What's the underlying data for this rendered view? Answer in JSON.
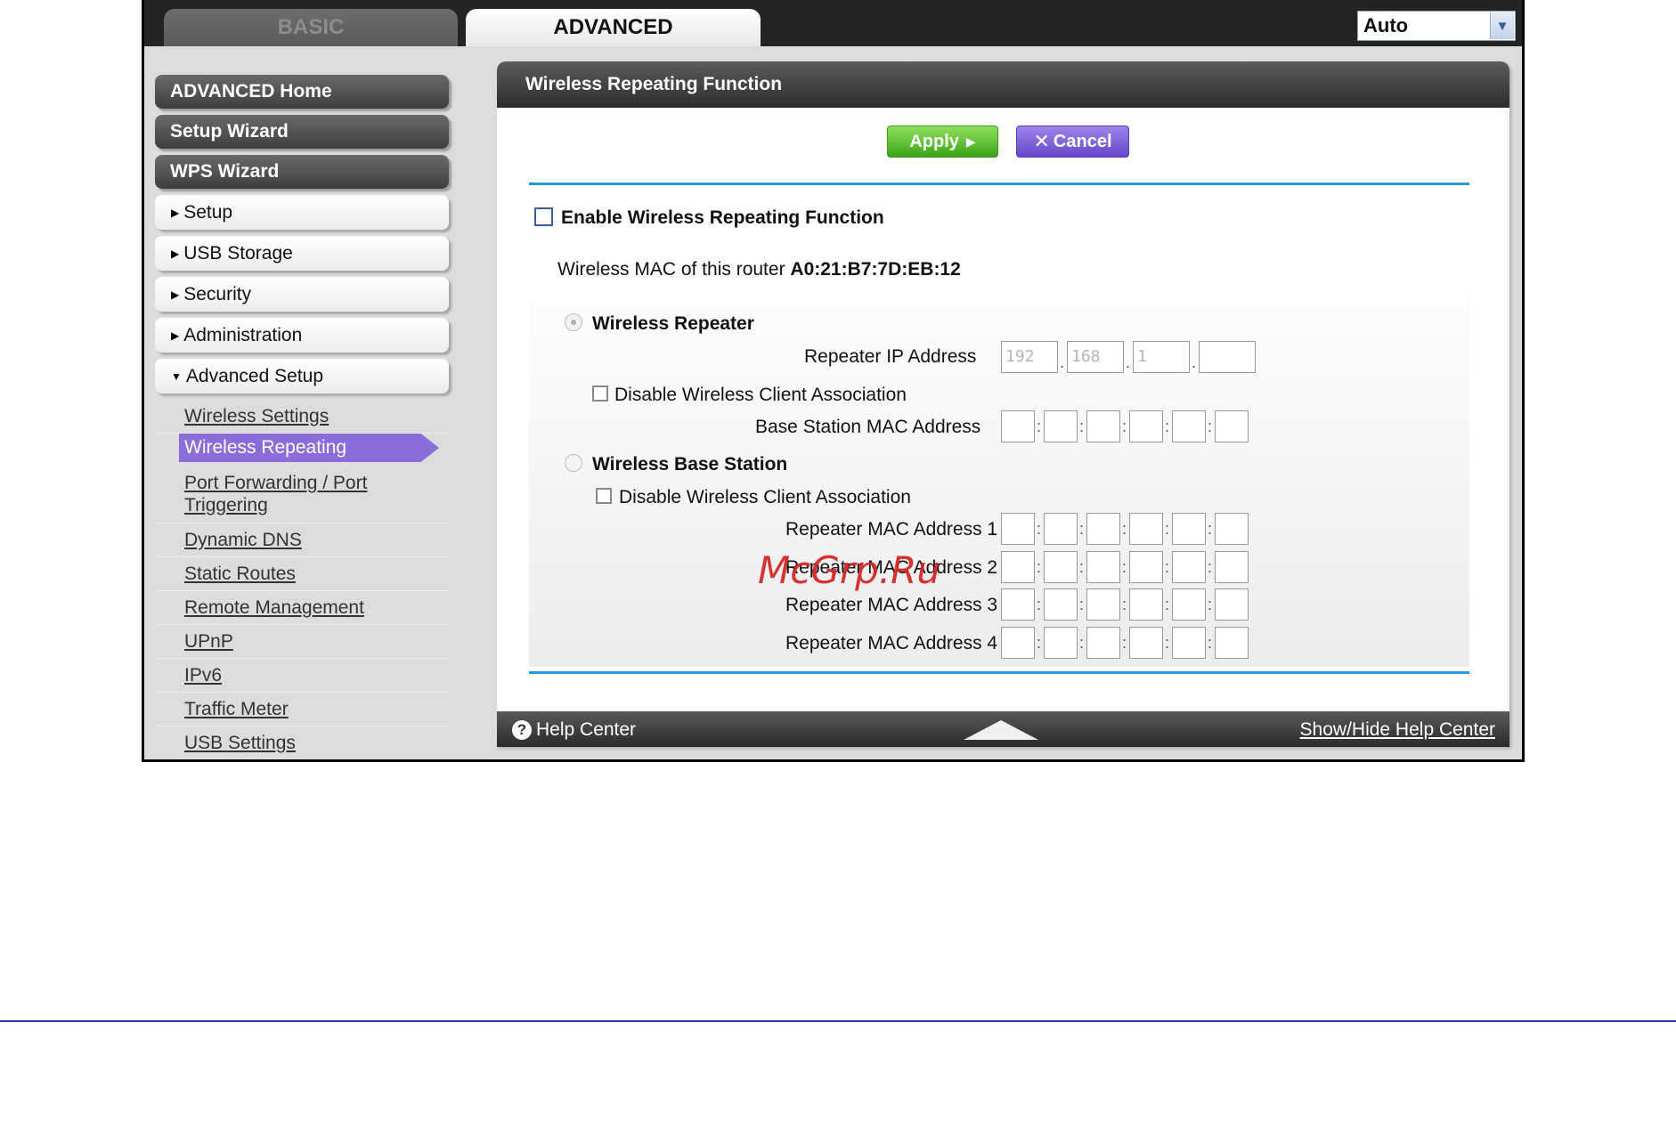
{
  "tabs": {
    "basic": "BASIC",
    "advanced": "ADVANCED"
  },
  "language": {
    "selected": "Auto"
  },
  "sidebar": {
    "advanced_home": "ADVANCED Home",
    "setup_wizard": "Setup Wizard",
    "wps_wizard": "WPS Wizard",
    "setup": "Setup",
    "usb_storage": "USB Storage",
    "security": "Security",
    "administration": "Administration",
    "advanced_setup": "Advanced Setup",
    "sub": {
      "wireless_settings": "Wireless Settings",
      "wireless_repeating": "Wireless Repeating",
      "port_forwarding_l1": "Port Forwarding / Port",
      "port_forwarding_l2": "Triggering",
      "dynamic_dns": "Dynamic DNS",
      "static_routes": "Static Routes",
      "remote_management": "Remote Management",
      "upnp": "UPnP",
      "ipv6": "IPv6",
      "traffic_meter": "Traffic Meter",
      "usb_settings": "USB Settings"
    }
  },
  "panel": {
    "title": "Wireless Repeating Function",
    "apply": "Apply",
    "cancel": "Cancel",
    "enable_label": "Enable Wireless Repeating Function",
    "mac_label": "Wireless MAC of this router",
    "mac_value": "A0:21:B7:7D:EB:12",
    "repeater": {
      "label": "Wireless Repeater",
      "ip_label": "Repeater IP Address",
      "ip": [
        "192",
        "168",
        "1",
        ""
      ],
      "disable_assoc": "Disable Wireless Client Association",
      "base_mac_label": "Base Station MAC Address"
    },
    "base_station": {
      "label": "Wireless Base Station",
      "disable_assoc": "Disable Wireless Client Association",
      "mac1": "Repeater MAC Address 1",
      "mac2": "Repeater MAC Address 2",
      "mac3": "Repeater MAC Address 3",
      "mac4": "Repeater MAC Address 4"
    }
  },
  "help": {
    "center": "Help Center",
    "toggle": "Show/Hide Help Center"
  },
  "watermark": "McGrp.Ru",
  "colors": {
    "accent_blue": "#1f9ad6",
    "apply_green": "#3aa618",
    "cancel_purple": "#6747c8",
    "active_purple": "#8a6dd8"
  }
}
